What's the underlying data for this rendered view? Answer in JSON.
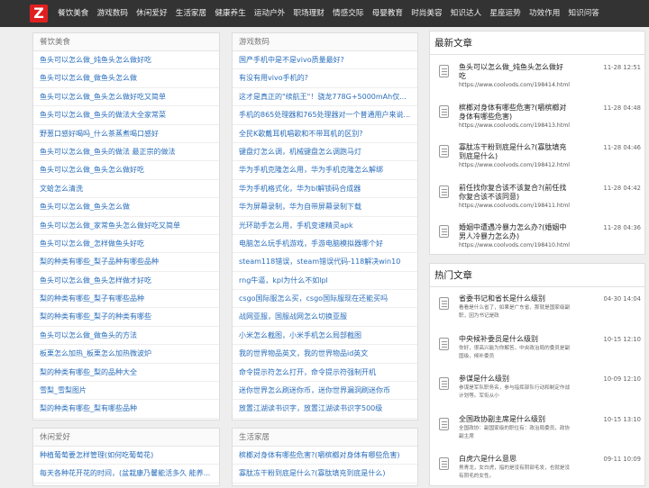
{
  "logo_letter": "Z",
  "nav": [
    "餐饮美食",
    "游戏数码",
    "休闲爱好",
    "生活家居",
    "健康养生",
    "运动户外",
    "职场理财",
    "情感交际",
    "母婴教育",
    "时尚美容",
    "知识达人",
    "星座运势",
    "功效作用",
    "知识问答"
  ],
  "col1": {
    "title": "餐饮美食",
    "items": [
      "鱼头可以怎么做_炖鱼头怎么做好吃",
      "鱼头可以怎么做_做鱼头怎么做",
      "鱼头可以怎么做_鱼头怎么做好吃又简单",
      "鱼头可以怎么做_鱼头的做法大全家常菜",
      "野葱口感好喝吗_什么茶蒸煮喝口感好",
      "鱼头可以怎么做_鱼头的做法 最正宗的做法",
      "鱼头可以怎么做_鱼头怎么做好吃",
      "文蛤怎么清洗",
      "鱼头可以怎么做_鱼头怎么做",
      "鱼头可以怎么做_家常鱼头怎么做好吃又简单",
      "鱼头可以怎么做_怎样做鱼头好吃",
      "梨的种类有哪些_梨子品种有哪些品种",
      "鱼头可以怎么做_鱼头怎样做才好吃",
      "梨的种类有哪些_梨子有哪些品种",
      "梨的种类有哪些_梨子的种类有哪些",
      "鱼头可以怎么做_做鱼头的方法",
      "板栗怎么加热_板栗怎么加热微波炉",
      "梨的种类有哪些_梨的品种大全",
      "雪梨_雪梨图片",
      "梨的种类有哪些_梨有哪些品种"
    ]
  },
  "col2": {
    "title": "游戏数码",
    "items": [
      "国产手机中是不是vivo质量最好?",
      "有没有用vivo手机的?",
      "这才是真正的\"续航王\"！骁龙778G+5000mAh仅...",
      "手机的865处理器和765处理器对一个普通用户来说...",
      "全民K歌戴耳机唱歌和不带耳机的区别?",
      "键盘灯怎么调，机械键盘怎么调跑马灯",
      "华为手机克隆怎么用，华为手机克隆怎么解绑",
      "华为手机格式化，华为bl解锁码合成器",
      "华为屏幕录制，华为自带屏幕录制下载",
      "光环助手怎么用，手机变速精灵apk",
      "电脑怎么玩手机游戏，手游电脑模拟器哪个好",
      "steam118错误，steam错误代码-118解决win10",
      "rng牛逼，kpl为什么不如lpl",
      "csgo国际服怎么买，csgo国际服现在还能买吗",
      "战网亚服，国服战网怎么切换亚服",
      "小米怎么截图，小米手机怎么局部截图",
      "我的世界物品英文，我的世界物品id英文",
      "命令提示符怎么打开，命令提示符强制开机",
      "迷你世界怎么刷迷你币，迷你世界漏洞刷迷你币",
      "放置江湖读书识字，放置江湖读书识字500级"
    ]
  },
  "col3": {
    "title": "休闲爱好",
    "items": [
      "种植葡萄要怎样管理(如何吃葡萄花)",
      "每天各种花开花的时间，(盆栽康乃馨能活多久 能养..."
    ]
  },
  "col4": {
    "title": "生活家居",
    "items": [
      "槟榔对身体有哪些危害?(嚼槟榔对身体有哪些危害)",
      "寡肽冻干粉到底是什么?(寡肽填充到底是什么)"
    ]
  },
  "latest": {
    "title": "最新文章",
    "items": [
      {
        "title": "鱼头可以怎么做_炖鱼头怎么做好吃",
        "url": "https://www.coolvods.com/198414.html",
        "date": "11-28 12:51"
      },
      {
        "title": "槟榔对身体有哪些危害?(嚼槟榔对身体有哪些危害)",
        "url": "https://www.coolvods.com/198413.html",
        "date": "11-28 04:48"
      },
      {
        "title": "寡肽冻干粉到底是什么?(寡肽填充到底是什么)",
        "url": "https://www.coolvods.com/198412.html",
        "date": "11-28 04:46"
      },
      {
        "title": "前任找你复合该不该复合?(前任找你复合该不该同意)",
        "url": "https://www.coolvods.com/198411.html",
        "date": "11-28 04:42"
      },
      {
        "title": "婚姻中遭遇冷暴力怎么办?(婚姻中男人冷暴力怎么办)",
        "url": "https://www.coolvods.com/198410.html",
        "date": "11-28 04:36"
      }
    ]
  },
  "hot": {
    "title": "热门文章",
    "items": [
      {
        "title": "省委书记和省长是什么级别",
        "snippet": "看看是什么省了，如果是广东省，那就是国家级副职，因为书记是政",
        "date": "04-30 14:04"
      },
      {
        "title": "中央候补委员是什么级别",
        "snippet": "你好，很高兴能为你解答，中央政治局的委员是副国级，候补委员",
        "date": "10-15 12:10"
      },
      {
        "title": "参谋是什么级别",
        "snippet": "参谋是军队职务名，参与指挥部队行动和制定作战计划等。军衔从小",
        "date": "10-09 12:10"
      },
      {
        "title": "全国政协副主席是什么级别",
        "snippet": "全国政协：副国家级的职位有：政治局委员，政协副主席",
        "date": "10-15 13:10"
      },
      {
        "title": "白虎六是什么意思",
        "snippet": "男青龙，女白虎，指的是没有阴部毛发，也就是没有阴毛的女性。",
        "date": "09-11 10:09"
      }
    ]
  }
}
